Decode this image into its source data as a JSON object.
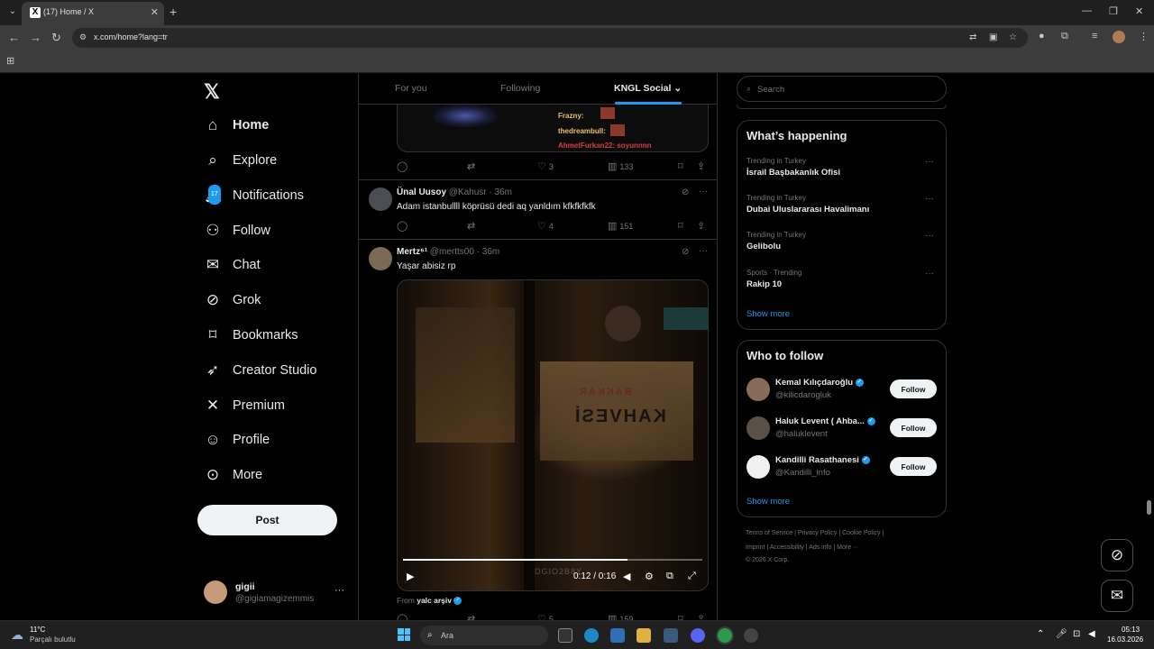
{
  "browser": {
    "tab_title": "(17) Home / X",
    "url": "x.com/home?lang=tr"
  },
  "sidebar": {
    "items": [
      {
        "label": "Home",
        "icon": "home-icon"
      },
      {
        "label": "Explore",
        "icon": "search-icon"
      },
      {
        "label": "Notifications",
        "icon": "bell-icon",
        "badge": "17"
      },
      {
        "label": "Follow",
        "icon": "add-user-icon"
      },
      {
        "label": "Chat",
        "icon": "mail-icon"
      },
      {
        "label": "Grok",
        "icon": "grok-icon"
      },
      {
        "label": "Bookmarks",
        "icon": "bookmark-icon"
      },
      {
        "label": "Creator Studio",
        "icon": "rocket-icon"
      },
      {
        "label": "Premium",
        "icon": "x-icon"
      },
      {
        "label": "Profile",
        "icon": "person-icon"
      },
      {
        "label": "More",
        "icon": "more-circle-icon"
      }
    ],
    "post_label": "Post",
    "account": {
      "name": "gigii",
      "handle": "@gigiamagizemmis"
    }
  },
  "timeline": {
    "tabs": [
      "For you",
      "Following",
      "KNGL Social"
    ],
    "prev_chat": [
      "Frazny:",
      "thedreambull:",
      "AhmetFurkan22: soyunnnn"
    ],
    "prev_actions": {
      "likes": "3",
      "views": "133"
    },
    "tweet1": {
      "name": "Ünal Uusoy",
      "meta": "@Kahusr · 36m",
      "text": "Adam istanbullll köprüsü dedi aq yanldım kfkfkfkfk",
      "likes": "4",
      "views": "151"
    },
    "tweet2": {
      "name": "Mertz⁶¹",
      "meta": "@mertts00 · 36m",
      "text": "Yaşar abisiz rp",
      "video_time": "0:12 / 0:16",
      "video_progress": 0.75,
      "watermark": "DGIO2B8Y",
      "sign_top": "BAKKAR",
      "sign_main": "KAHVESİ",
      "from_prefix": "From",
      "from_name": "yalc arşiv",
      "likes": "5",
      "views": "159"
    }
  },
  "right": {
    "search_placeholder": "Search",
    "happening_title": "What’s happening",
    "trends": [
      {
        "context": "Trending in Turkey",
        "name": "İsrail Başbakanlık Ofisi"
      },
      {
        "context": "Trending in Turkey",
        "name": "Dubai Uluslararası Havalimanı"
      },
      {
        "context": "Trending in Turkey",
        "name": "Gelibolu"
      },
      {
        "context": "Sports · Trending",
        "name": "Rakip 10"
      }
    ],
    "show_more": "Show more",
    "wtf_title": "Who to follow",
    "wtf": [
      {
        "name": "Kemal Kılıçdaroğlu",
        "handle": "@kilicdarogluk",
        "btn": "Follow"
      },
      {
        "name": "Haluk Levent ( Ahba...",
        "handle": "@haluklevent",
        "btn": "Follow"
      },
      {
        "name": "Kandilli Rasathanesi",
        "handle": "@Kandilli_info",
        "btn": "Follow"
      }
    ],
    "footer1": "Terms of Service  |  Privacy Policy  |  Cookie Policy  |",
    "footer2": "Imprint  |  Accessibility  |  Ads info  |  More ···",
    "footer3": "© 2026 X Corp."
  },
  "taskbar": {
    "temp": "11°C",
    "weather": "Parçalı bulutlu",
    "search_placeholder": "Ara",
    "time": "05:13",
    "date": "16.03.2026"
  }
}
